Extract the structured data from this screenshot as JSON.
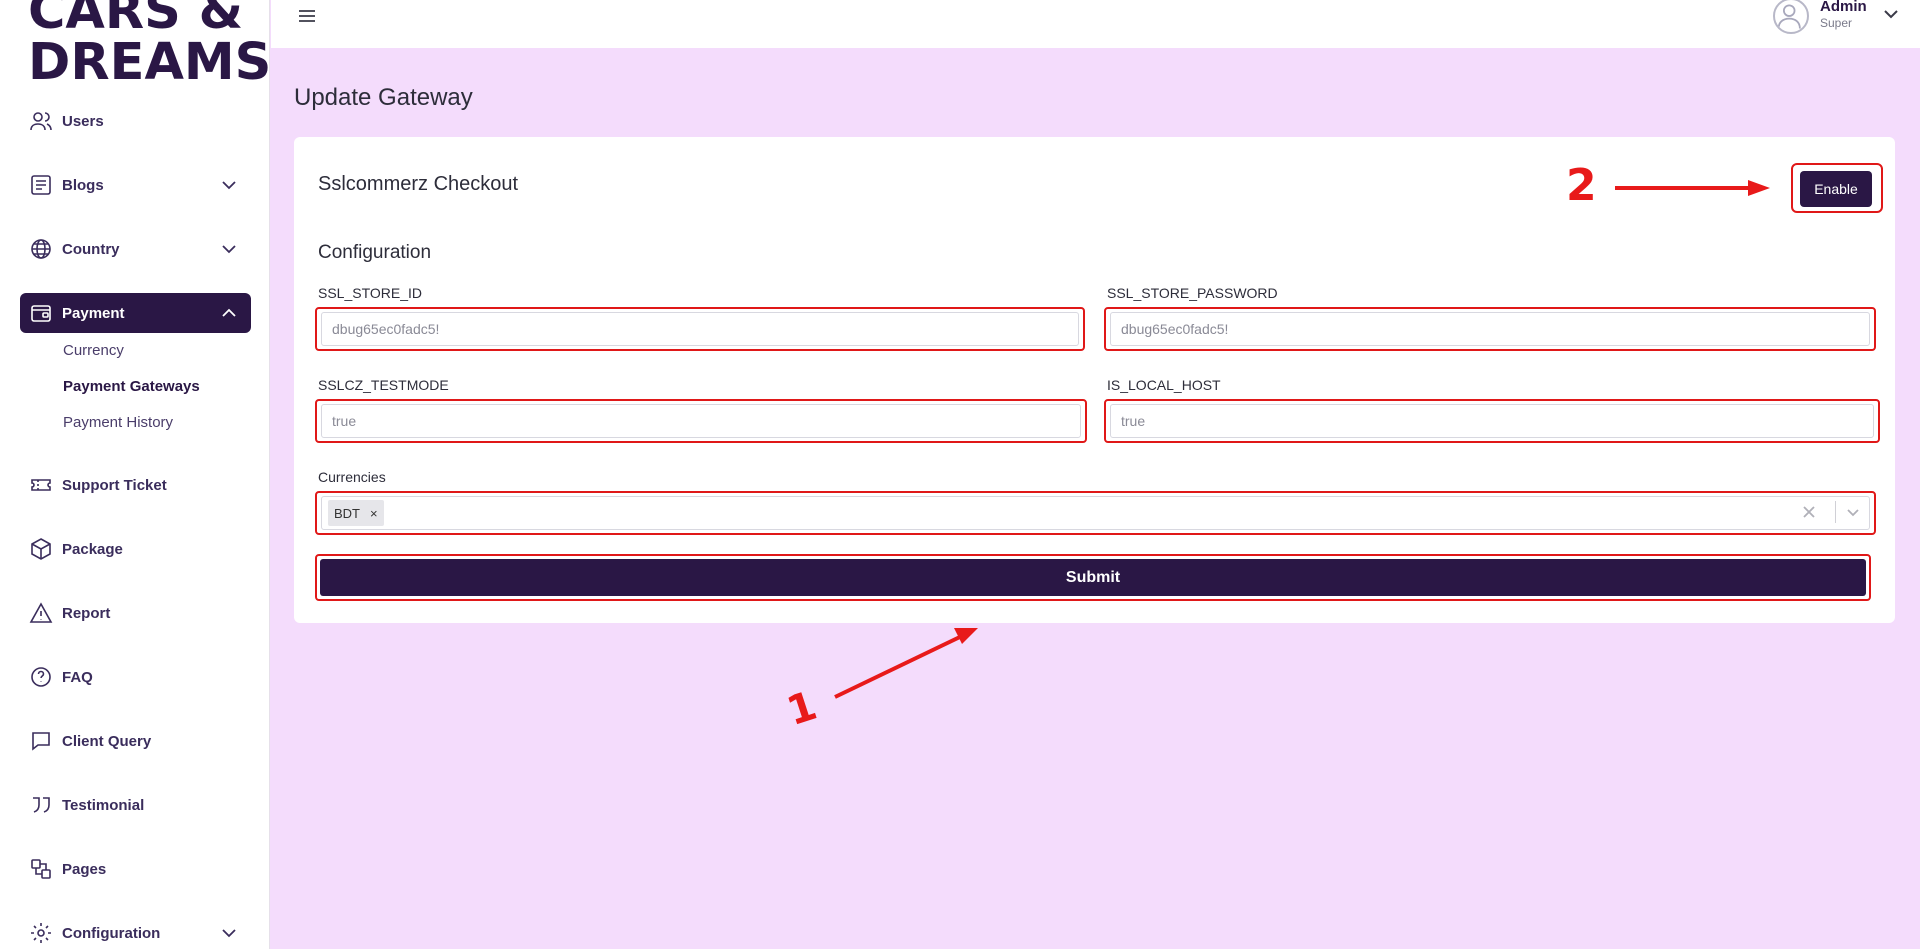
{
  "brand": {
    "logo_line1": "CARS &",
    "logo_line2": "DREAMS"
  },
  "sidebar": {
    "items": [
      {
        "label": "Users",
        "icon": "users-icon"
      },
      {
        "label": "Blogs",
        "icon": "document-icon"
      },
      {
        "label": "Country",
        "icon": "globe-icon"
      },
      {
        "label": "Payment",
        "icon": "wallet-icon",
        "active": true
      },
      {
        "label": "Support Ticket",
        "icon": "ticket-icon"
      },
      {
        "label": "Package",
        "icon": "package-icon"
      },
      {
        "label": "Report",
        "icon": "warning-icon"
      },
      {
        "label": "FAQ",
        "icon": "question-icon"
      },
      {
        "label": "Client Query",
        "icon": "chat-icon"
      },
      {
        "label": "Testimonial",
        "icon": "quote-icon"
      },
      {
        "label": "Pages",
        "icon": "pages-icon"
      },
      {
        "label": "Configuration",
        "icon": "gear-icon"
      }
    ],
    "payment_sub": [
      {
        "label": "Currency"
      },
      {
        "label": "Payment Gateways",
        "active": true
      },
      {
        "label": "Payment History"
      }
    ]
  },
  "header": {
    "user_name": "Admin",
    "user_role": "Super"
  },
  "main": {
    "page_title": "Update Gateway",
    "card_title": "Sslcommerz Checkout",
    "enable_label": "Enable",
    "section_title": "Configuration",
    "fields": [
      {
        "label": "SSL_STORE_ID",
        "value": "dbug65ec0fadc5!"
      },
      {
        "label": "SSL_STORE_PASSWORD",
        "value": "dbug65ec0fadc5!"
      },
      {
        "label": "SSLCZ_TESTMODE",
        "value": "true"
      },
      {
        "label": "IS_LOCAL_HOST",
        "value": "true"
      }
    ],
    "currencies_label": "Currencies",
    "currencies": [
      "BDT"
    ],
    "tag_remove": "×",
    "submit_label": "Submit"
  },
  "annotations": {
    "arrow1_number": "1",
    "arrow2_number": "2",
    "color": "#e81a1a"
  },
  "colors": {
    "brand": "#2a1745",
    "background": "#f4dcfc",
    "highlight": "#e01818"
  }
}
